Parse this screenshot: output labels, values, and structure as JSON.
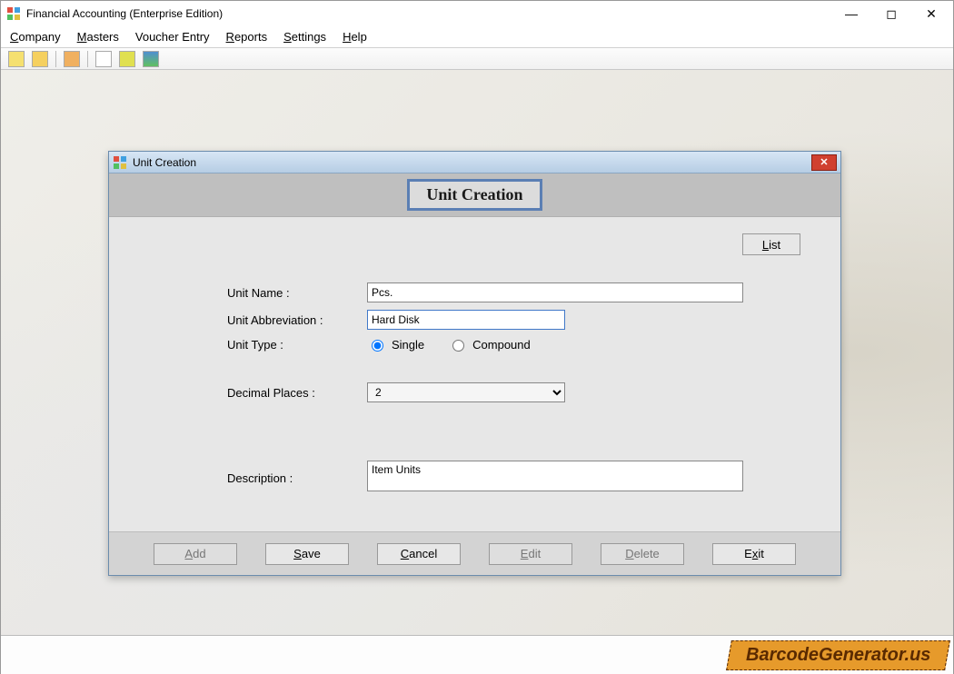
{
  "window": {
    "title": "Financial Accounting (Enterprise Edition)"
  },
  "menu": {
    "company": "Company",
    "masters": "Masters",
    "voucher": "Voucher Entry",
    "reports": "Reports",
    "settings": "Settings",
    "help": "Help"
  },
  "dialog": {
    "title": "Unit Creation",
    "heading": "Unit Creation",
    "list_btn": "List",
    "labels": {
      "unit_name": "Unit Name :",
      "unit_abbrev": "Unit Abbreviation :",
      "unit_type": "Unit Type :",
      "decimal_places": "Decimal Places :",
      "description": "Description :"
    },
    "values": {
      "unit_name": "Pcs.",
      "unit_abbrev": "Hard Disk",
      "radio_single": "Single",
      "radio_compound": "Compound",
      "decimal_places": "2",
      "description": "Item Units"
    },
    "buttons": {
      "add": "Add",
      "save": "Save",
      "cancel": "Cancel",
      "edit": "Edit",
      "delete": "Delete",
      "exit": "Exit"
    }
  },
  "brand": "BarcodeGenerator.us"
}
